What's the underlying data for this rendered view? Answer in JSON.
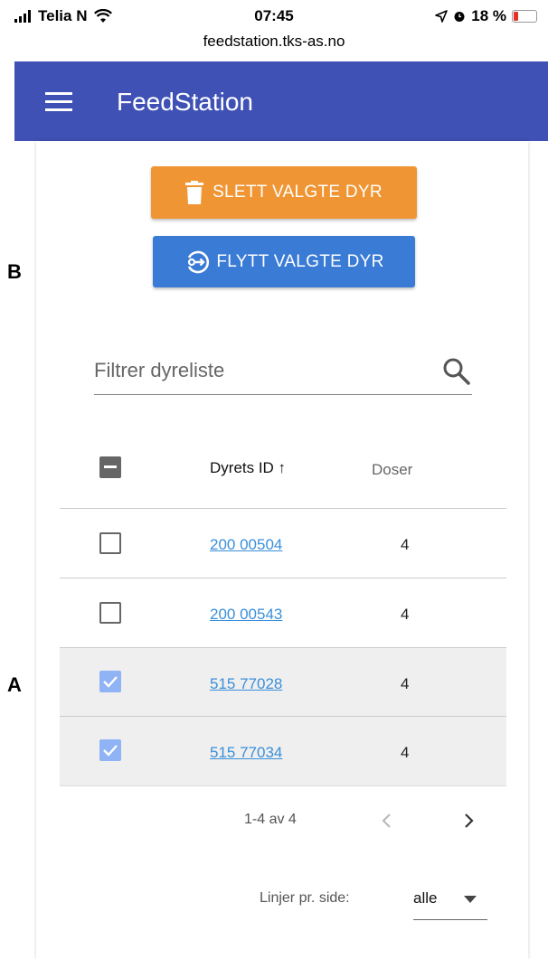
{
  "status_bar": {
    "carrier": "Telia N",
    "time": "07:45",
    "battery": "18 %",
    "url": "feedstation.tks-as.no"
  },
  "app_bar": {
    "title": "FeedStation"
  },
  "actions": {
    "delete_label": "SLETT VALGTE DYR",
    "move_label": "FLYTT VALGTE DYR"
  },
  "annotations": {
    "b": "B",
    "a": "A"
  },
  "search": {
    "placeholder": "Filtrer dyreliste",
    "value": ""
  },
  "table": {
    "headers": {
      "id": "Dyrets ID ↑",
      "doses": "Doser"
    },
    "rows": [
      {
        "id": "200 00504",
        "doses": "4",
        "selected": false
      },
      {
        "id": "200 00543",
        "doses": "4",
        "selected": false
      },
      {
        "id": "515 77028",
        "doses": "4",
        "selected": true
      },
      {
        "id": "515 77034",
        "doses": "4",
        "selected": true
      }
    ]
  },
  "pagination": {
    "range": "1-4 av 4",
    "rows_per_page_label": "Linjer pr. side:",
    "rows_per_page_value": "alle"
  },
  "colors": {
    "app_bar": "#3f51b5",
    "delete_button": "#f09533",
    "move_button": "#3a7bd5",
    "link": "#3a8fd9",
    "checkbox_checked": "#8fb3f5"
  }
}
